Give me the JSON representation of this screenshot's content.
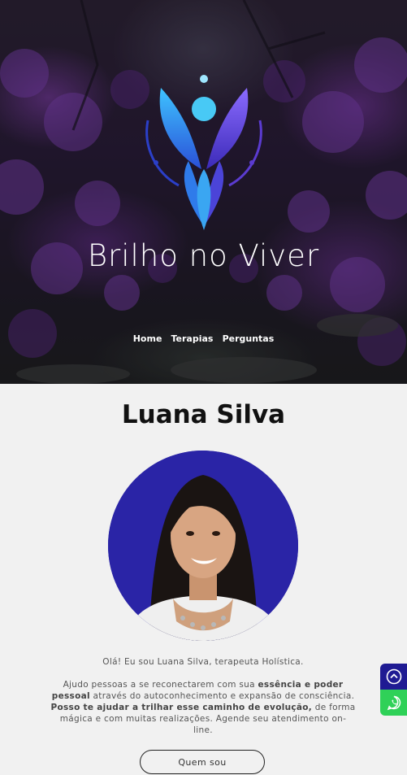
{
  "site": {
    "brand": "Brilho no Viver",
    "nav": [
      "Home",
      "Terapias",
      "Perguntas"
    ]
  },
  "profile": {
    "name": "Luana Silva",
    "intro_line": "Olá! Eu sou Luana Silva, terapeuta Holística.",
    "para_a": "Ajudo pessoas a se reconectarem com sua ",
    "para_b": "essência e poder pessoal",
    "para_c": " através do autoconhecimento e expansão de consciência. ",
    "para_d": "Posso te ajudar a trilhar esse caminho de evolução,",
    "para_e": " de forma mágica e com muitas realizações. Agende seu atendimento on-line.",
    "button_label": "Quem sou"
  },
  "floating": {
    "scroll_top_icon": "chevron-up-icon",
    "whatsapp_icon": "whatsapp-icon"
  },
  "colors": {
    "avatar_bg": "#2a24a6",
    "scroll_top_bg": "#1f1b93",
    "whatsapp_bg": "#2fd158"
  }
}
